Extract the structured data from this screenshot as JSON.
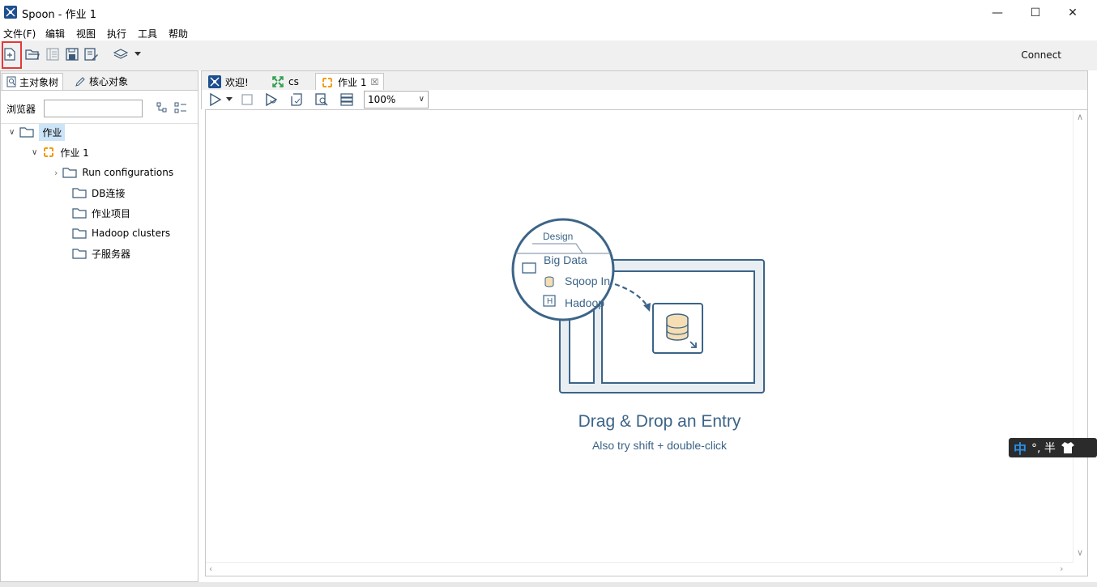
{
  "window": {
    "title": "Spoon - 作业 1",
    "minimize": "—",
    "maximize": "☐",
    "close": "✕"
  },
  "menu": [
    "文件(F)",
    "编辑",
    "视图",
    "执行",
    "工具",
    "帮助"
  ],
  "toolbar": {
    "connect_label": "Connect",
    "icons": [
      "new-icon",
      "open-icon",
      "explore-icon",
      "save-icon",
      "save-as-icon",
      "layers-icon",
      "dropdown-icon"
    ]
  },
  "left_panel": {
    "tabs": [
      {
        "label": "主对象树",
        "icon": "search-doc-icon"
      },
      {
        "label": "核心对象",
        "icon": "pencil-icon"
      }
    ],
    "browser_label": "浏览器",
    "browser_value": "",
    "tree": [
      {
        "label": "作业",
        "level": 0,
        "expanded": true,
        "icon": "folder-icon",
        "selected": true
      },
      {
        "label": "作业 1",
        "level": 1,
        "expanded": true,
        "icon": "job-icon"
      },
      {
        "label": "Run configurations",
        "level": 2,
        "expanded": false,
        "icon": "folder-icon",
        "has_children": true
      },
      {
        "label": "DB连接",
        "level": 2,
        "icon": "folder-icon"
      },
      {
        "label": "作业项目",
        "level": 2,
        "icon": "folder-icon"
      },
      {
        "label": "Hadoop clusters",
        "level": 2,
        "icon": "folder-icon"
      },
      {
        "label": "子服务器",
        "level": 2,
        "icon": "folder-icon"
      }
    ]
  },
  "tabs": [
    {
      "label": "欢迎!",
      "icon": "spoon-icon",
      "active": false
    },
    {
      "label": "cs",
      "icon": "transformation-icon",
      "active": false
    },
    {
      "label": "作业 1",
      "icon": "job-icon",
      "active": true,
      "close": "☒"
    }
  ],
  "canvas_toolbar": {
    "zoom": "100%"
  },
  "canvas_hint": {
    "design_tab": "Design",
    "folder_label": "Big Data",
    "item1": "Sqoop In",
    "item2": "Hadoop",
    "item2_badge": "H",
    "title": "Drag & Drop an Entry",
    "subtitle": "Also try shift + double-click"
  },
  "ime": {
    "mode": "中",
    "rest": "°, 半"
  },
  "colors": {
    "accent_blue": "#3c6488",
    "highlight_red": "#e53935",
    "selection": "#cce4f7",
    "job_orange": "#f39c12"
  }
}
